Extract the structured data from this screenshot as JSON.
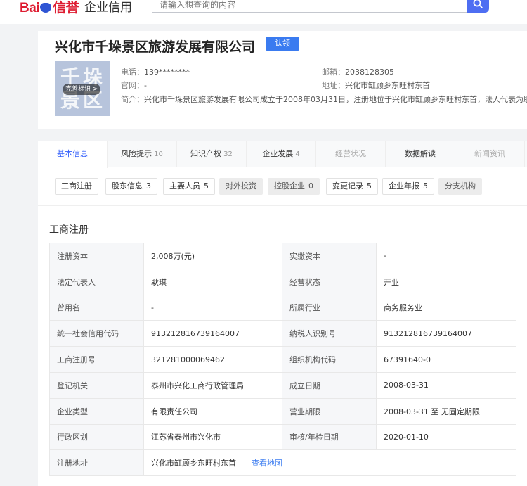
{
  "header": {
    "logo_left": "Bai",
    "logo_right": "信誉",
    "product": "企业信用",
    "search_placeholder": "请输入想查询的内容"
  },
  "company": {
    "name": "兴化市千垛景区旅游发展有限公司",
    "claim_label": "认领",
    "logo_chars": "千垛景区",
    "logo_badge": "完善标识 >",
    "phone_label": "电话：",
    "phone": "139********",
    "email_label": "邮箱：",
    "email": "2038128305",
    "website_label": "官网：",
    "website": "-",
    "address_label": "地址：",
    "address": "兴化市缸顾乡东旺村东首",
    "intro_label": "简介：",
    "intro": "兴化市千垛景区旅游发展有限公司成立于2008年03月31日，注册地位于兴化市缸顾乡东旺村东首，法人代表为耿"
  },
  "tabs": [
    {
      "label": "基本信息",
      "count": ""
    },
    {
      "label": "风险提示",
      "count": "10"
    },
    {
      "label": "知识产权",
      "count": "32"
    },
    {
      "label": "企业发展",
      "count": "4"
    },
    {
      "label": "经营状况",
      "count": ""
    },
    {
      "label": "数据解读",
      "count": ""
    },
    {
      "label": "新闻资讯",
      "count": ""
    }
  ],
  "subtabs": [
    {
      "label": "工商注册",
      "count": ""
    },
    {
      "label": "股东信息",
      "count": "3"
    },
    {
      "label": "主要人员",
      "count": "5"
    },
    {
      "label": "对外投资",
      "count": ""
    },
    {
      "label": "控股企业",
      "count": "0"
    },
    {
      "label": "变更记录",
      "count": "5"
    },
    {
      "label": "企业年报",
      "count": "5"
    },
    {
      "label": "分支机构",
      "count": ""
    }
  ],
  "section_title": "工商注册",
  "registration": {
    "rows": [
      [
        "注册资本",
        "2,008万(元)",
        "实缴资本",
        "-"
      ],
      [
        "法定代表人",
        "耿琪",
        "经营状态",
        "开业"
      ],
      [
        "曾用名",
        "-",
        "所属行业",
        "商务服务业"
      ],
      [
        "统一社会信用代码",
        "913212816739164007",
        "纳税人识别号",
        "913212816739164007"
      ],
      [
        "工商注册号",
        "321281000069462",
        "组织机构代码",
        "67391640-0"
      ],
      [
        "登记机关",
        "泰州市兴化工商行政管理局",
        "成立日期",
        "2008-03-31"
      ],
      [
        "企业类型",
        "有限责任公司",
        "营业期限",
        "2008-03-31 至 无固定期限"
      ],
      [
        "行政区划",
        "江苏省泰州市兴化市",
        "审核/年检日期",
        "2020-01-10"
      ]
    ],
    "address_label": "注册地址",
    "address_value": "兴化市缸顾乡东旺村东首",
    "map_link": "查看地图"
  },
  "colors": {
    "accent": "#315efb",
    "brand_red": "#de1c31",
    "claim": "#3a7bf0"
  }
}
